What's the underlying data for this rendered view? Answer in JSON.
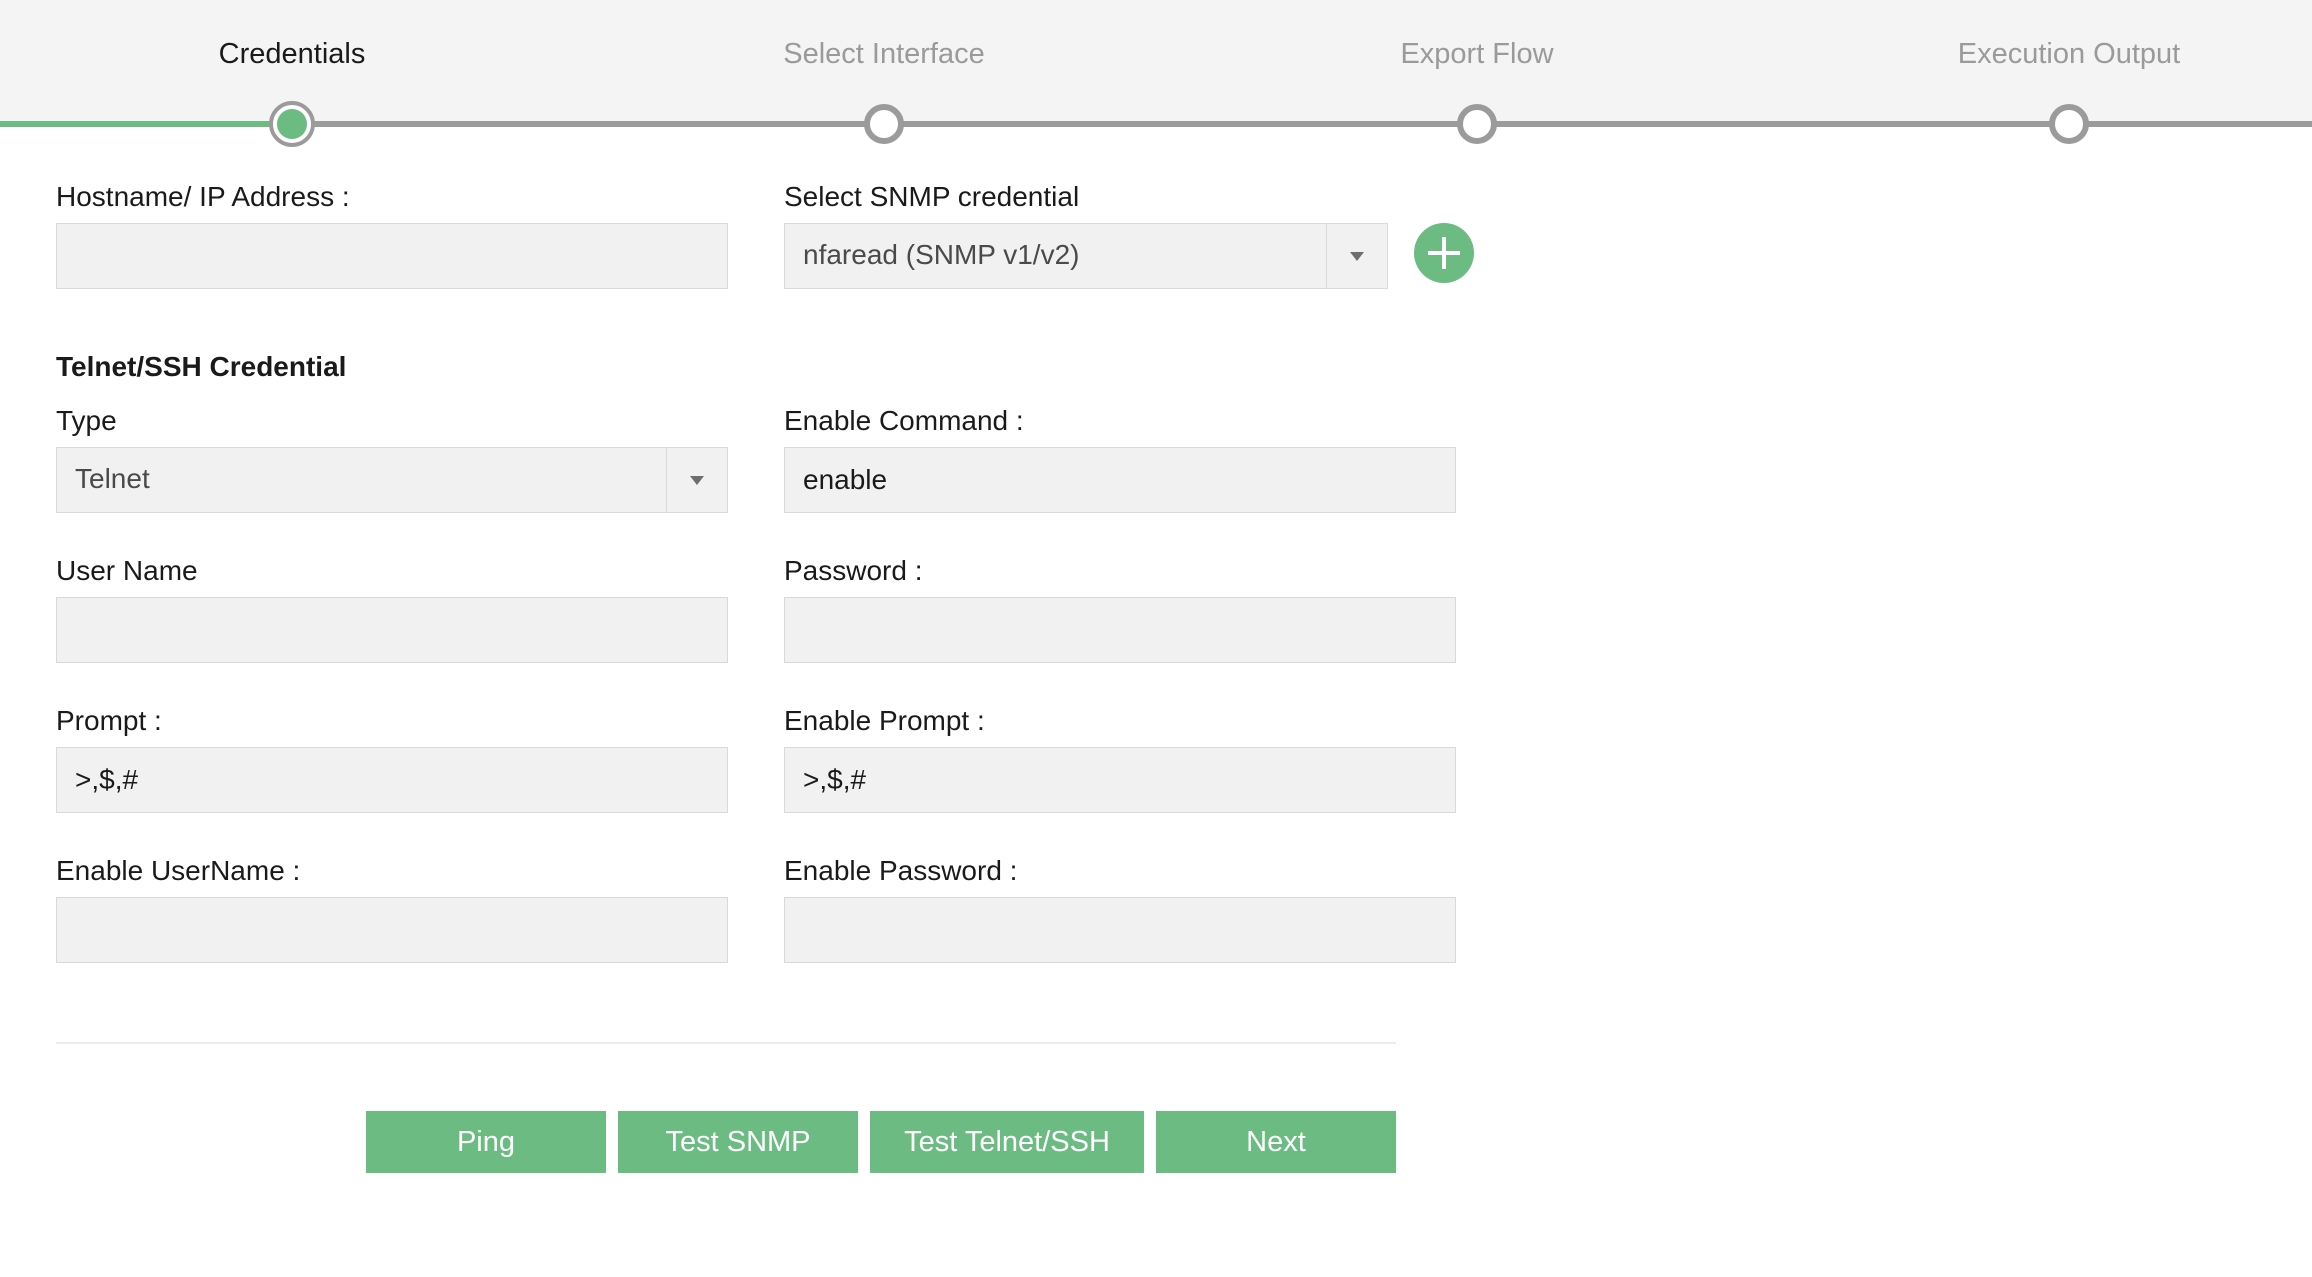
{
  "wizard": {
    "steps": [
      {
        "label": "Credentials",
        "state": "active"
      },
      {
        "label": "Select Interface",
        "state": "pending"
      },
      {
        "label": "Export Flow",
        "state": "pending"
      },
      {
        "label": "Execution Output",
        "state": "pending"
      }
    ]
  },
  "form": {
    "hostname": {
      "label": "Hostname/ IP Address :",
      "value": ""
    },
    "snmp": {
      "label": "Select SNMP credential",
      "value": "nfaread (SNMP v1/v2)"
    },
    "telnet_section": {
      "title": "Telnet/SSH Credential"
    },
    "type": {
      "label": "Type",
      "value": "Telnet"
    },
    "enable_command": {
      "label": "Enable Command :",
      "value": "enable"
    },
    "username": {
      "label": "User Name",
      "value": ""
    },
    "password": {
      "label": "Password :",
      "value": ""
    },
    "prompt": {
      "label": "Prompt :",
      "value": ">,$,#"
    },
    "enable_prompt": {
      "label": "Enable Prompt :",
      "value": ">,$,#"
    },
    "enable_username": {
      "label": "Enable UserName :",
      "value": ""
    },
    "enable_password": {
      "label": "Enable Password :",
      "value": ""
    }
  },
  "buttons": {
    "ping": "Ping",
    "test_snmp": "Test SNMP",
    "test_telnet": "Test Telnet/SSH",
    "next": "Next"
  },
  "colors": {
    "accent": "#6cbb82",
    "track": "#9b9b9b",
    "header_bg": "#f4f4f5",
    "field_bg": "#f1f1f1"
  },
  "icons": {
    "add_credential": "plus-circle-icon",
    "dropdown": "chevron-down-icon"
  }
}
